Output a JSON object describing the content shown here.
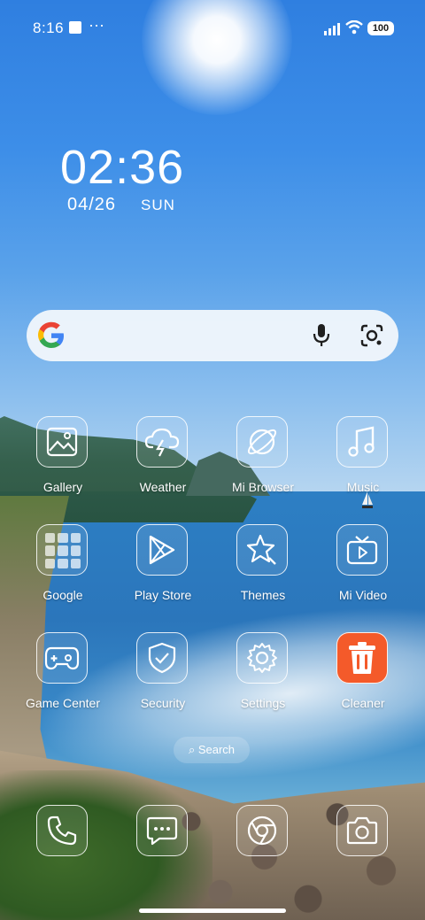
{
  "status_bar": {
    "time": "8:16",
    "more": "···",
    "battery": "100"
  },
  "clock_widget": {
    "time": "02:36",
    "date": "04/26",
    "day": "SUN"
  },
  "apps": {
    "gallery": "Gallery",
    "weather": "Weather",
    "mi_browser": "Mi Browser",
    "music": "Music",
    "google": "Google",
    "play_store": "Play Store",
    "themes": "Themes",
    "mi_video": "Mi Video",
    "game_center": "Game Center",
    "security": "Security",
    "settings": "Settings",
    "cleaner": "Cleaner"
  },
  "home_search": {
    "label": "Search"
  },
  "colors": {
    "cleaner": "#f45a2a",
    "google_blue": "#4285F4",
    "google_red": "#EA4335",
    "google_yellow": "#FBBC05",
    "google_green": "#34A853"
  }
}
